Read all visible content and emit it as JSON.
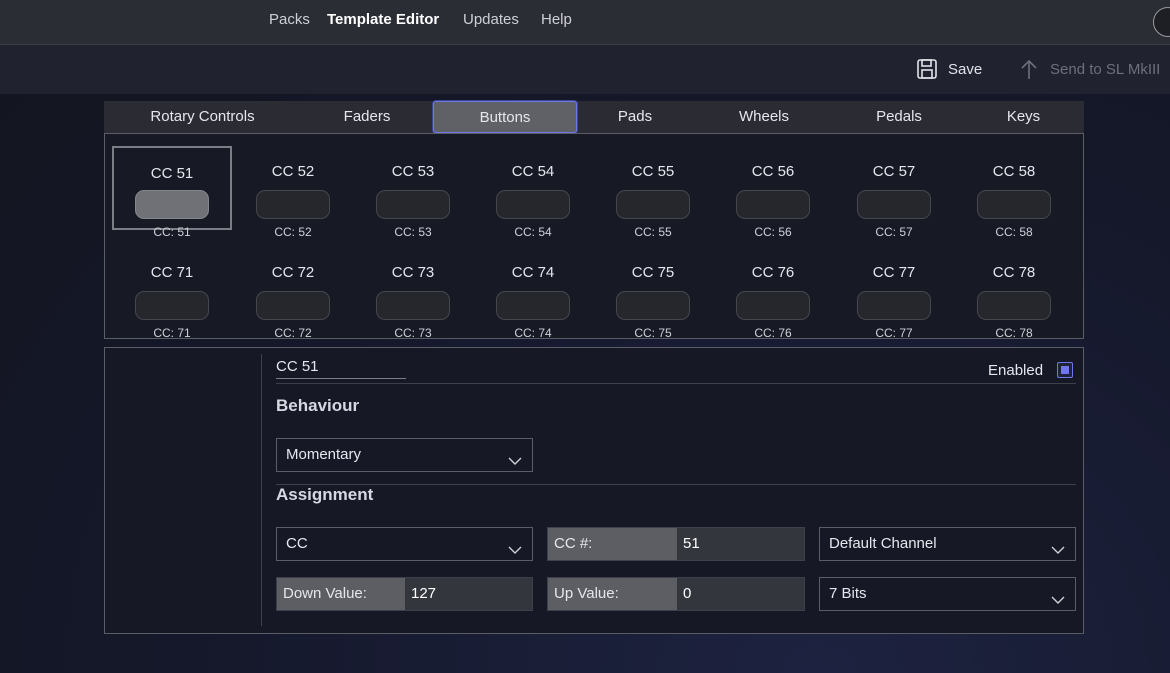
{
  "menu": {
    "items": [
      "Packs",
      "Template Editor",
      "Updates",
      "Help"
    ],
    "active": "Template Editor"
  },
  "toolbar": {
    "save_label": "Save",
    "send_label": "Send to SL MkIII",
    "save_icon": "floppy-disk-icon",
    "send_icon": "arrow-up-icon"
  },
  "tabs": [
    "Rotary Controls",
    "Faders",
    "Buttons",
    "Pads",
    "Wheels",
    "Pedals",
    "Keys"
  ],
  "active_tab": "Buttons",
  "controls": {
    "row1": [
      {
        "title": "CC 51",
        "sub": "CC: 51"
      },
      {
        "title": "CC 52",
        "sub": "CC: 52"
      },
      {
        "title": "CC 53",
        "sub": "CC: 53"
      },
      {
        "title": "CC 54",
        "sub": "CC: 54"
      },
      {
        "title": "CC 55",
        "sub": "CC: 55"
      },
      {
        "title": "CC 56",
        "sub": "CC: 56"
      },
      {
        "title": "CC 57",
        "sub": "CC: 57"
      },
      {
        "title": "CC 58",
        "sub": "CC: 58"
      }
    ],
    "row2": [
      {
        "title": "CC 71",
        "sub": "CC: 71"
      },
      {
        "title": "CC 72",
        "sub": "CC: 72"
      },
      {
        "title": "CC 73",
        "sub": "CC: 73"
      },
      {
        "title": "CC 74",
        "sub": "CC: 74"
      },
      {
        "title": "CC 75",
        "sub": "CC: 75"
      },
      {
        "title": "CC 76",
        "sub": "CC: 76"
      },
      {
        "title": "CC 77",
        "sub": "CC: 77"
      },
      {
        "title": "CC 78",
        "sub": "CC: 78"
      }
    ]
  },
  "detail": {
    "name": "CC 51",
    "enabled_label": "Enabled",
    "enabled": true,
    "behaviour_title": "Behaviour",
    "behaviour_value": "Momentary",
    "assignment_title": "Assignment",
    "assignment_type": "CC",
    "cc_number_label": "CC #:",
    "cc_number_value": "51",
    "channel_value": "Default Channel",
    "down_value_label": "Down Value:",
    "down_value": "127",
    "up_value_label": "Up Value:",
    "up_value": "0",
    "bits_value": "7 Bits"
  },
  "colors": {
    "accent": "#6f78e8",
    "background": "#171a2b",
    "menubar": "#2b2d35"
  }
}
